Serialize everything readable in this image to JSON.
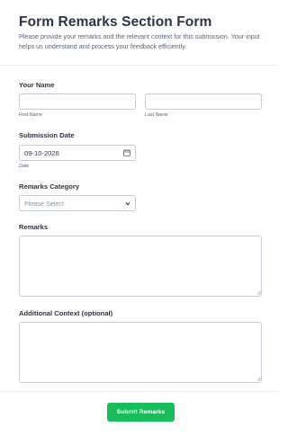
{
  "header": {
    "title": "Form Remarks Section Form",
    "description": "Please provide your remarks and the relevant context for this submission. Your input helps us understand and process your feedback efficiently."
  },
  "name_field": {
    "label": "Your Name",
    "first_sublabel": "First Name",
    "last_sublabel": "Last Name",
    "first_value": "",
    "last_value": ""
  },
  "date_field": {
    "label": "Submission Date",
    "value": "09-10-2026",
    "sublabel": "Date",
    "icon": "calendar-icon"
  },
  "category_field": {
    "label": "Remarks Category",
    "selected": "Please Select",
    "icon": "chevron-down-icon"
  },
  "remarks_field": {
    "label": "Remarks",
    "value": ""
  },
  "context_field": {
    "label": "Additional Context (optional)",
    "value": ""
  },
  "submit": {
    "label": "Submit Remarks",
    "color": "#18bd5b"
  }
}
